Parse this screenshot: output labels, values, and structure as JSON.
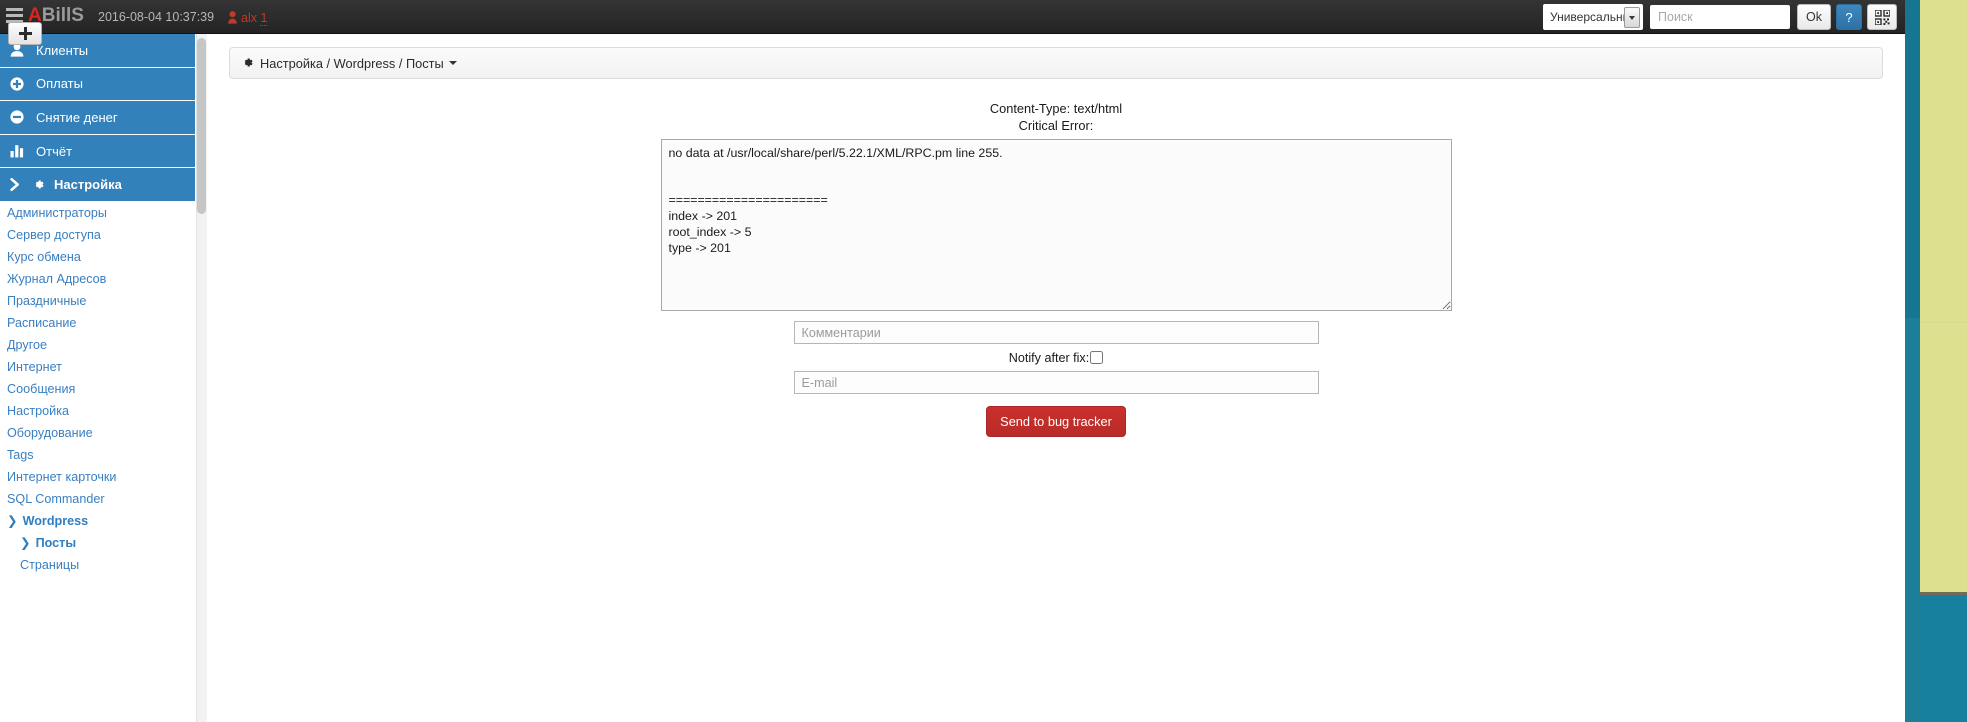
{
  "topbar": {
    "brand_a": "A",
    "brand_rest": "BillS",
    "timestamp": "2016-08-04 10:37:39",
    "user_name": "alx",
    "user_count": "1",
    "search_scope": "Универсальный",
    "search_placeholder": "Поиск",
    "ok_label": "Ok",
    "help_label": "?",
    "icons": {
      "menu": "hamburger-icon",
      "user": "user-icon",
      "qr": "qr-code-icon",
      "dropdown": "chevron-down-icon"
    },
    "colors": {
      "bar_bg": "#2b2b2b",
      "brand_accent": "#d9251d",
      "user_accent": "#c0392b",
      "help_bg": "#2d72a7"
    }
  },
  "new_tab": {
    "label": "+"
  },
  "sidebar": {
    "main_items": [
      {
        "label": "Клиенты",
        "icon": "user-icon",
        "bold": false
      },
      {
        "label": "Оплаты",
        "icon": "plus-circle-icon",
        "bold": false
      },
      {
        "label": "Снятие денег",
        "icon": "minus-circle-icon",
        "bold": false
      },
      {
        "label": "Отчёт",
        "icon": "bar-chart-icon",
        "bold": false
      },
      {
        "label": "Настройка",
        "icon": "gear-icon",
        "bold": true,
        "chevron": "›"
      }
    ],
    "links": [
      {
        "label": "Администраторы",
        "strong": false,
        "indent": 0
      },
      {
        "label": "Сервер доступа",
        "strong": false,
        "indent": 0
      },
      {
        "label": "Курс обмена",
        "strong": false,
        "indent": 0
      },
      {
        "label": "Журнал Адресов",
        "strong": false,
        "indent": 0
      },
      {
        "label": "Праздничные",
        "strong": false,
        "indent": 0
      },
      {
        "label": "Расписание",
        "strong": false,
        "indent": 0
      },
      {
        "label": "Другое",
        "strong": false,
        "indent": 0
      },
      {
        "label": "Интернет",
        "strong": false,
        "indent": 0
      },
      {
        "label": "Сообщения",
        "strong": false,
        "indent": 0
      },
      {
        "label": "Настройка",
        "strong": false,
        "indent": 0
      },
      {
        "label": "Оборудование",
        "strong": false,
        "indent": 0
      },
      {
        "label": "Tags",
        "strong": false,
        "indent": 0
      },
      {
        "label": "Интернет карточки",
        "strong": false,
        "indent": 0
      },
      {
        "label": "SQL Commander",
        "strong": false,
        "indent": 0
      },
      {
        "label": "Wordpress",
        "strong": true,
        "indent": 0,
        "chevron": "❯"
      },
      {
        "label": "Посты",
        "strong": true,
        "indent": 1,
        "chevron": "❯"
      },
      {
        "label": "Страницы",
        "strong": false,
        "indent": 1
      }
    ],
    "colors": {
      "item_bg": "#3281ba",
      "link_color": "#3a7fc1"
    }
  },
  "breadcrumb": {
    "gear_icon": "gear-icon",
    "text": "Настройка / Wordpress / Посты"
  },
  "main": {
    "content_type_line": "Content-Type: text/html",
    "critical_error_line": "Critical Error:",
    "error_text": "no data at /usr/local/share/perl/5.22.1/XML/RPC.pm line 255.\n\n\n======================\nindex -> 201\nroot_index -> 5\ntype -> 201",
    "comment_placeholder": "Комментарии",
    "comment_value": "",
    "notify_label": "Notify after fix:",
    "notify_checked": false,
    "email_placeholder": "E-mail",
    "email_value": "",
    "send_label": "Send to bug tracker",
    "send_color": "#c9302c"
  }
}
